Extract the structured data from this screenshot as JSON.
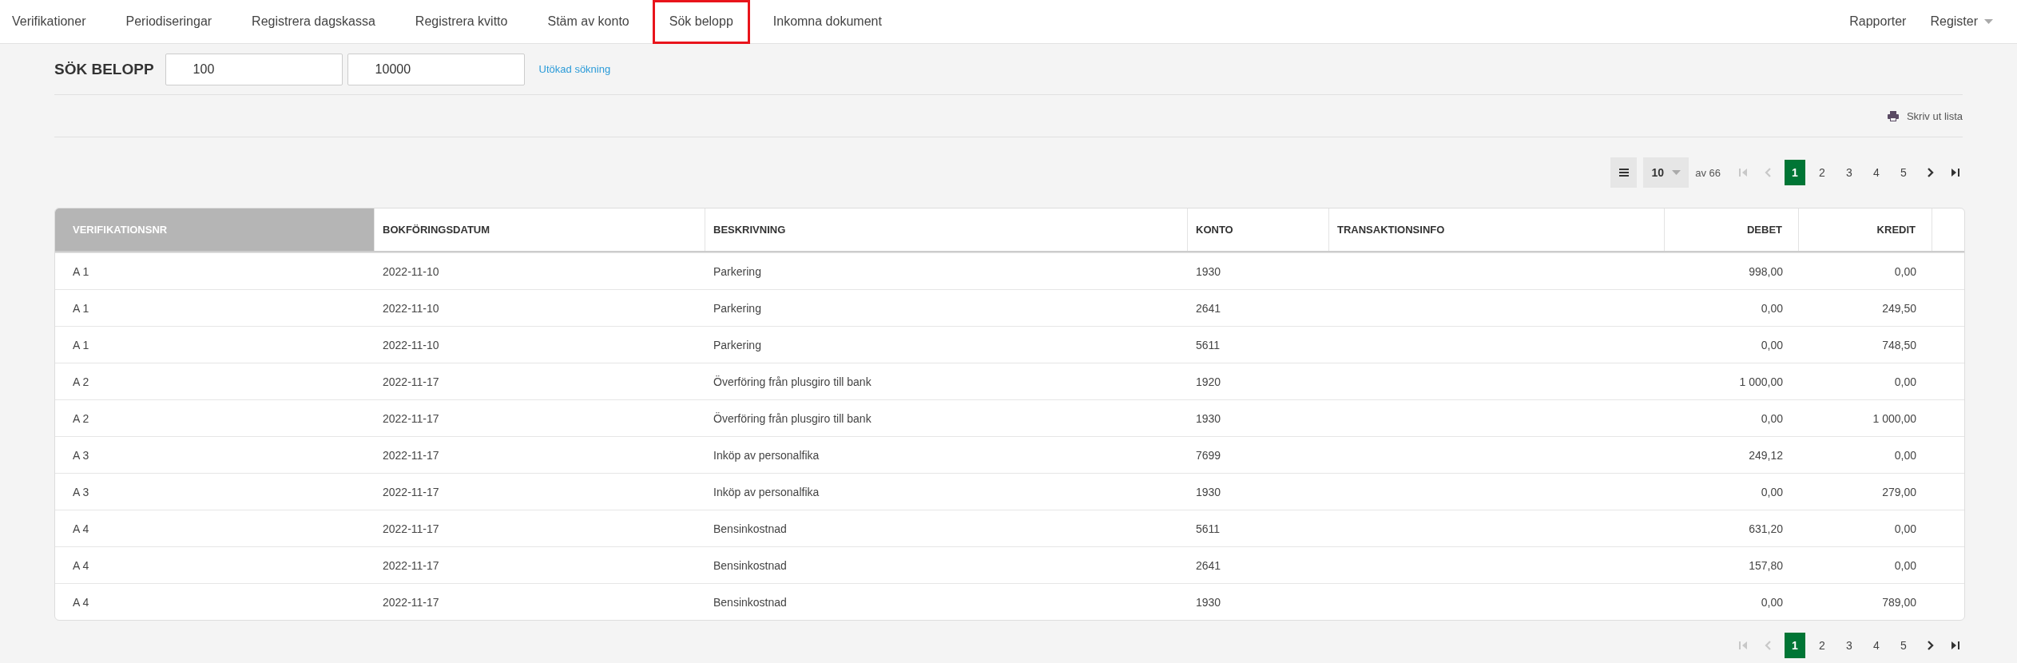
{
  "nav": {
    "items": [
      {
        "label": "Verifikationer",
        "selected": false
      },
      {
        "label": "Periodiseringar",
        "selected": false
      },
      {
        "label": "Registrera dagskassa",
        "selected": false
      },
      {
        "label": "Registrera kvitto",
        "selected": false
      },
      {
        "label": "Stäm av konto",
        "selected": false
      },
      {
        "label": "Sök belopp",
        "selected": true
      },
      {
        "label": "Inkomna dokument",
        "selected": false
      }
    ],
    "right": [
      {
        "label": "Rapporter",
        "kind": "link"
      },
      {
        "label": "Register",
        "kind": "dropdown"
      }
    ]
  },
  "search": {
    "title": "SÖK BELOPP",
    "from": "100",
    "to": "10000",
    "advanced_link": "Utökad sökning"
  },
  "print_link": "Skriv ut lista",
  "page_size": "10",
  "total": "av 66",
  "pagination_top": {
    "first_disabled": true,
    "prev_disabled": true,
    "pages": [
      {
        "label": "1",
        "selected": true
      },
      {
        "label": "2",
        "selected": false
      },
      {
        "label": "3",
        "selected": false
      },
      {
        "label": "4",
        "selected": false
      },
      {
        "label": "5",
        "selected": false
      }
    ]
  },
  "table": {
    "columns": [
      {
        "label": "VERIFIKATIONSNR",
        "sorted": true
      },
      {
        "label": "BOKFÖRINGSDATUM",
        "sorted": false
      },
      {
        "label": "BESKRIVNING",
        "sorted": false
      },
      {
        "label": "KONTO",
        "sorted": false
      },
      {
        "label": "TRANSAKTIONSINFO",
        "sorted": false
      },
      {
        "label": "DEBET",
        "sorted": false
      },
      {
        "label": "KREDIT",
        "sorted": false
      }
    ],
    "rows": [
      [
        "A 1",
        "2022-11-10",
        "Parkering",
        "1930",
        "",
        "998,00",
        "0,00"
      ],
      [
        "A 1",
        "2022-11-10",
        "Parkering",
        "2641",
        "",
        "0,00",
        "249,50"
      ],
      [
        "A 1",
        "2022-11-10",
        "Parkering",
        "5611",
        "",
        "0,00",
        "748,50"
      ],
      [
        "A 2",
        "2022-11-17",
        "Överföring från plusgiro till bank",
        "1920",
        "",
        "1 000,00",
        "0,00"
      ],
      [
        "A 2",
        "2022-11-17",
        "Överföring från plusgiro till bank",
        "1930",
        "",
        "0,00",
        "1 000,00"
      ],
      [
        "A 3",
        "2022-11-17",
        "Inköp av personalfika",
        "7699",
        "",
        "249,12",
        "0,00"
      ],
      [
        "A 3",
        "2022-11-17",
        "Inköp av personalfika",
        "1930",
        "",
        "0,00",
        "279,00"
      ],
      [
        "A 4",
        "2022-11-17",
        "Bensinkostnad",
        "5611",
        "",
        "631,20",
        "0,00"
      ],
      [
        "A 4",
        "2022-11-17",
        "Bensinkostnad",
        "2641",
        "",
        "157,80",
        "0,00"
      ],
      [
        "A 4",
        "2022-11-17",
        "Bensinkostnad",
        "1930",
        "",
        "0,00",
        "789,00"
      ]
    ]
  },
  "pagination_bottom": {
    "first_disabled": true,
    "prev_disabled": true,
    "pages": [
      {
        "label": "1",
        "selected": true
      },
      {
        "label": "2",
        "selected": false
      },
      {
        "label": "3",
        "selected": false
      },
      {
        "label": "4",
        "selected": false
      },
      {
        "label": "5",
        "selected": false
      }
    ]
  }
}
